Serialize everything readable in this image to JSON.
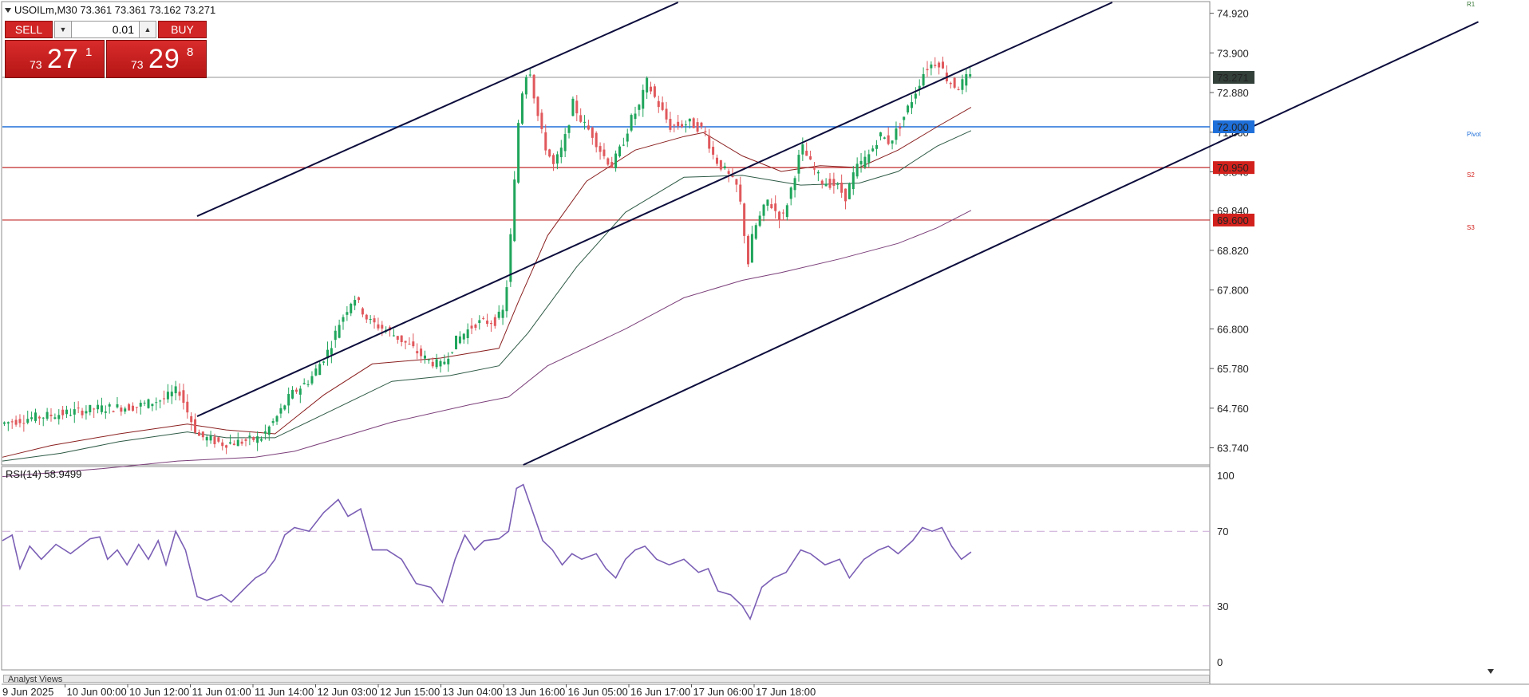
{
  "header": {
    "symbol_info": "USOILm,M30  73.361 73.361 73.162 73.271",
    "symbol_icon": "triangle-down-icon"
  },
  "trade_panel": {
    "sell_label": "SELL",
    "buy_label": "BUY",
    "lot_value": "0.01",
    "sell_price": {
      "prefix": "73",
      "main": "27",
      "sup": "1"
    },
    "buy_price": {
      "prefix": "73",
      "main": "29",
      "sup": "8"
    }
  },
  "price_axis": {
    "ticks": [
      "74.920",
      "73.900",
      "72.880",
      "71.860",
      "70.840",
      "69.840",
      "68.820",
      "67.800",
      "66.800",
      "65.780",
      "64.760",
      "63.740"
    ],
    "tick_values": [
      74.92,
      73.9,
      72.88,
      71.86,
      70.84,
      69.84,
      68.82,
      67.8,
      66.8,
      65.78,
      64.76,
      63.74
    ]
  },
  "levels": [
    {
      "label": "73.271",
      "value": 73.271,
      "color": "#33403a",
      "line_color": "#a9a9a9",
      "tag": ""
    },
    {
      "label": "72.000",
      "value": 72.0,
      "color": "#1e6fd9",
      "line_color": "#1e6fd9",
      "tag": "Pivot"
    },
    {
      "label": "70.950",
      "value": 70.95,
      "color": "#d2211c",
      "line_color": "#c22a2a",
      "tag": "S2"
    },
    {
      "label": "69.600",
      "value": 69.6,
      "color": "#d2211c",
      "line_color": "#c22a2a",
      "tag": "S3"
    }
  ],
  "top_right_tag": "R1",
  "time_axis": {
    "labels": [
      "9 Jun 2025",
      "10 Jun 00:00",
      "10 Jun 12:00",
      "11 Jun 01:00",
      "11 Jun 14:00",
      "12 Jun 03:00",
      "12 Jun 15:00",
      "13 Jun 04:00",
      "13 Jun 16:00",
      "16 Jun 05:00",
      "16 Jun 17:00",
      "17 Jun 06:00",
      "17 Jun 18:00"
    ]
  },
  "rsi": {
    "title": "RSI(14) 58.9499",
    "ticks": [
      "100",
      "70",
      "30",
      "0"
    ],
    "tick_values": [
      100,
      70,
      30,
      0
    ],
    "line_color": "#7b5fb5"
  },
  "bottom_bar": {
    "label": "Analyst Views"
  },
  "chart_data": {
    "type": "candlestick",
    "title": "USOILm,M30",
    "ylim": [
      63.3,
      75.2
    ],
    "x_range": [
      0,
      1000
    ],
    "price_path": [
      [
        0,
        64.35
      ],
      [
        30,
        64.5
      ],
      [
        60,
        64.6
      ],
      [
        100,
        64.75
      ],
      [
        140,
        64.8
      ],
      [
        170,
        65.0
      ],
      [
        185,
        65.25
      ],
      [
        195,
        64.6
      ],
      [
        205,
        64.05
      ],
      [
        230,
        63.85
      ],
      [
        250,
        63.9
      ],
      [
        270,
        64.0
      ],
      [
        285,
        64.5
      ],
      [
        300,
        65.1
      ],
      [
        320,
        65.5
      ],
      [
        340,
        66.3
      ],
      [
        350,
        66.95
      ],
      [
        365,
        67.65
      ],
      [
        380,
        67.0
      ],
      [
        400,
        66.75
      ],
      [
        420,
        66.4
      ],
      [
        440,
        66.0
      ],
      [
        455,
        65.85
      ],
      [
        470,
        66.5
      ],
      [
        490,
        66.95
      ],
      [
        510,
        67.0
      ],
      [
        520,
        67.3
      ],
      [
        528,
        69.8
      ],
      [
        535,
        72.5
      ],
      [
        540,
        73.2
      ],
      [
        545,
        73.6
      ],
      [
        552,
        72.5
      ],
      [
        560,
        71.6
      ],
      [
        570,
        71.0
      ],
      [
        580,
        71.5
      ],
      [
        590,
        72.6
      ],
      [
        600,
        72.1
      ],
      [
        610,
        71.8
      ],
      [
        620,
        71.3
      ],
      [
        630,
        71.0
      ],
      [
        640,
        71.5
      ],
      [
        650,
        72.2
      ],
      [
        660,
        72.6
      ],
      [
        665,
        73.2
      ],
      [
        675,
        72.7
      ],
      [
        690,
        72.0
      ],
      [
        710,
        72.1
      ],
      [
        725,
        71.9
      ],
      [
        735,
        71.2
      ],
      [
        745,
        70.9
      ],
      [
        760,
        70.4
      ],
      [
        770,
        68.5
      ],
      [
        775,
        69.3
      ],
      [
        790,
        70.1
      ],
      [
        805,
        69.6
      ],
      [
        815,
        70.5
      ],
      [
        825,
        71.5
      ],
      [
        835,
        71.0
      ],
      [
        845,
        70.6
      ],
      [
        860,
        70.5
      ],
      [
        870,
        70.2
      ],
      [
        880,
        70.9
      ],
      [
        895,
        71.3
      ],
      [
        905,
        71.8
      ],
      [
        915,
        71.6
      ],
      [
        925,
        72.0
      ],
      [
        940,
        72.8
      ],
      [
        952,
        73.5
      ],
      [
        965,
        73.7
      ],
      [
        975,
        73.2
      ],
      [
        985,
        73.0
      ],
      [
        995,
        73.27
      ]
    ],
    "moving_averages": [
      {
        "color": "#8a1f1f",
        "path": [
          [
            0,
            63.5
          ],
          [
            50,
            63.8
          ],
          [
            120,
            64.1
          ],
          [
            190,
            64.35
          ],
          [
            230,
            64.2
          ],
          [
            280,
            64.1
          ],
          [
            330,
            65.1
          ],
          [
            380,
            65.9
          ],
          [
            450,
            66.05
          ],
          [
            510,
            66.3
          ],
          [
            530,
            67.5
          ],
          [
            560,
            69.2
          ],
          [
            600,
            70.6
          ],
          [
            650,
            71.4
          ],
          [
            700,
            71.75
          ],
          [
            720,
            71.85
          ],
          [
            760,
            71.25
          ],
          [
            800,
            70.85
          ],
          [
            840,
            71.0
          ],
          [
            880,
            70.95
          ],
          [
            920,
            71.4
          ],
          [
            960,
            72.0
          ],
          [
            995,
            72.5
          ]
        ]
      },
      {
        "color": "#2e5a46",
        "path": [
          [
            0,
            63.4
          ],
          [
            60,
            63.6
          ],
          [
            120,
            63.9
          ],
          [
            190,
            64.15
          ],
          [
            230,
            64.0
          ],
          [
            280,
            64.0
          ],
          [
            330,
            64.6
          ],
          [
            400,
            65.45
          ],
          [
            460,
            65.6
          ],
          [
            510,
            65.85
          ],
          [
            540,
            66.7
          ],
          [
            590,
            68.4
          ],
          [
            640,
            69.8
          ],
          [
            700,
            70.7
          ],
          [
            760,
            70.75
          ],
          [
            820,
            70.5
          ],
          [
            880,
            70.55
          ],
          [
            920,
            70.85
          ],
          [
            960,
            71.5
          ],
          [
            995,
            71.9
          ]
        ]
      },
      {
        "color": "#7b3f7a",
        "path": [
          [
            0,
            63.0
          ],
          [
            100,
            63.2
          ],
          [
            180,
            63.4
          ],
          [
            260,
            63.5
          ],
          [
            300,
            63.65
          ],
          [
            400,
            64.4
          ],
          [
            480,
            64.85
          ],
          [
            520,
            65.05
          ],
          [
            560,
            65.85
          ],
          [
            640,
            66.8
          ],
          [
            700,
            67.6
          ],
          [
            760,
            68.05
          ],
          [
            800,
            68.25
          ],
          [
            860,
            68.6
          ],
          [
            920,
            69.0
          ],
          [
            960,
            69.4
          ],
          [
            995,
            69.85
          ]
        ]
      }
    ],
    "channel": [
      {
        "from": [
          200,
          69.7
        ],
        "to": [
          694,
          75.2
        ]
      },
      {
        "from": [
          200,
          64.55
        ],
        "to": [
          1140,
          75.2
        ]
      },
      {
        "from": [
          535,
          63.3
        ],
        "to": [
          1516,
          74.7
        ]
      }
    ],
    "rsi_range": [
      0,
      100
    ],
    "rsi_levels": [
      70,
      30
    ],
    "rsi_path": [
      [
        0,
        65
      ],
      [
        10,
        68
      ],
      [
        18,
        50
      ],
      [
        28,
        62
      ],
      [
        40,
        55
      ],
      [
        55,
        63
      ],
      [
        70,
        58
      ],
      [
        90,
        66
      ],
      [
        100,
        67
      ],
      [
        108,
        55
      ],
      [
        118,
        60
      ],
      [
        128,
        52
      ],
      [
        140,
        63
      ],
      [
        150,
        55
      ],
      [
        160,
        65
      ],
      [
        168,
        52
      ],
      [
        178,
        70
      ],
      [
        188,
        60
      ],
      [
        200,
        35
      ],
      [
        210,
        33
      ],
      [
        225,
        36
      ],
      [
        235,
        32
      ],
      [
        250,
        40
      ],
      [
        260,
        45
      ],
      [
        270,
        48
      ],
      [
        280,
        55
      ],
      [
        290,
        68
      ],
      [
        300,
        72
      ],
      [
        315,
        70
      ],
      [
        330,
        80
      ],
      [
        345,
        87
      ],
      [
        355,
        78
      ],
      [
        368,
        82
      ],
      [
        380,
        60
      ],
      [
        395,
        60
      ],
      [
        410,
        55
      ],
      [
        425,
        42
      ],
      [
        440,
        40
      ],
      [
        452,
        32
      ],
      [
        465,
        55
      ],
      [
        475,
        68
      ],
      [
        485,
        60
      ],
      [
        495,
        65
      ],
      [
        510,
        66
      ],
      [
        520,
        70
      ],
      [
        528,
        93
      ],
      [
        535,
        95
      ],
      [
        545,
        80
      ],
      [
        555,
        65
      ],
      [
        565,
        60
      ],
      [
        575,
        52
      ],
      [
        585,
        58
      ],
      [
        595,
        55
      ],
      [
        610,
        58
      ],
      [
        620,
        50
      ],
      [
        630,
        45
      ],
      [
        640,
        55
      ],
      [
        650,
        60
      ],
      [
        660,
        62
      ],
      [
        672,
        55
      ],
      [
        685,
        52
      ],
      [
        700,
        55
      ],
      [
        715,
        48
      ],
      [
        725,
        50
      ],
      [
        735,
        38
      ],
      [
        748,
        36
      ],
      [
        760,
        30
      ],
      [
        768,
        23
      ],
      [
        780,
        40
      ],
      [
        792,
        45
      ],
      [
        805,
        48
      ],
      [
        820,
        60
      ],
      [
        830,
        58
      ],
      [
        845,
        52
      ],
      [
        860,
        55
      ],
      [
        870,
        45
      ],
      [
        885,
        55
      ],
      [
        900,
        60
      ],
      [
        910,
        62
      ],
      [
        920,
        58
      ],
      [
        935,
        65
      ],
      [
        945,
        72
      ],
      [
        955,
        70
      ],
      [
        965,
        72
      ],
      [
        975,
        62
      ],
      [
        985,
        55
      ],
      [
        995,
        58.9
      ]
    ]
  }
}
